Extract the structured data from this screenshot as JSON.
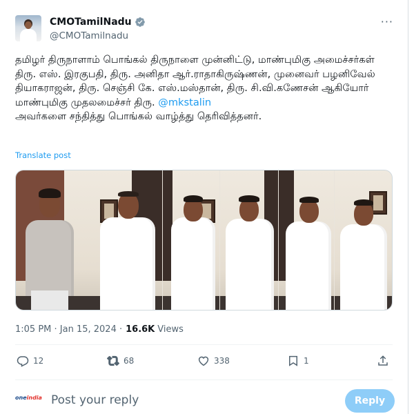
{
  "post": {
    "author_name": "CMOTamilNadu",
    "author_handle": "@CMOTamilnadu",
    "more_label": "···",
    "text_before_mention": "தமிழர் திருநாளாம் பொங்கல் திருநாளை முன்னிட்டு, மாண்புமிகு அமைச்சர்கள் திரு. எஸ். இரகுபதி, திரு. அனிதா ஆர்.ராதாகிருஷ்ணன், முனைவர் பழனிவேல் தியாகராஜன், திரு. செஞ்சி கே. எஸ்.மஸ்தான், திரு. சி.வி.கணேசன் ஆகியோர் மாண்புமிகு முதலமைச்சர் திரு. ",
    "mention": "@mkstalin",
    "text_after_mention": "அவர்களை சந்தித்து பொங்கல் வாழ்த்து தெரிவித்தனர்.",
    "translate_label": "Translate post",
    "time": "1:05 PM · Jan 15, 2024 ·",
    "views_count": "16.6K",
    "views_label": "Views"
  },
  "actions": {
    "replies": "12",
    "reposts": "68",
    "likes": "338",
    "bookmarks": "1"
  },
  "composer": {
    "avatar_text_a": "one",
    "avatar_text_b": "india",
    "placeholder": "Post your reply",
    "reply_button": "Reply"
  },
  "colors": {
    "accent": "#1d9bf0",
    "reply_button_disabled": "#8ecdf8",
    "secondary_text": "#536471"
  },
  "icons": [
    "verified-badge-icon",
    "more-options-icon",
    "reply-icon",
    "repost-icon",
    "like-icon",
    "bookmark-icon",
    "share-icon"
  ]
}
